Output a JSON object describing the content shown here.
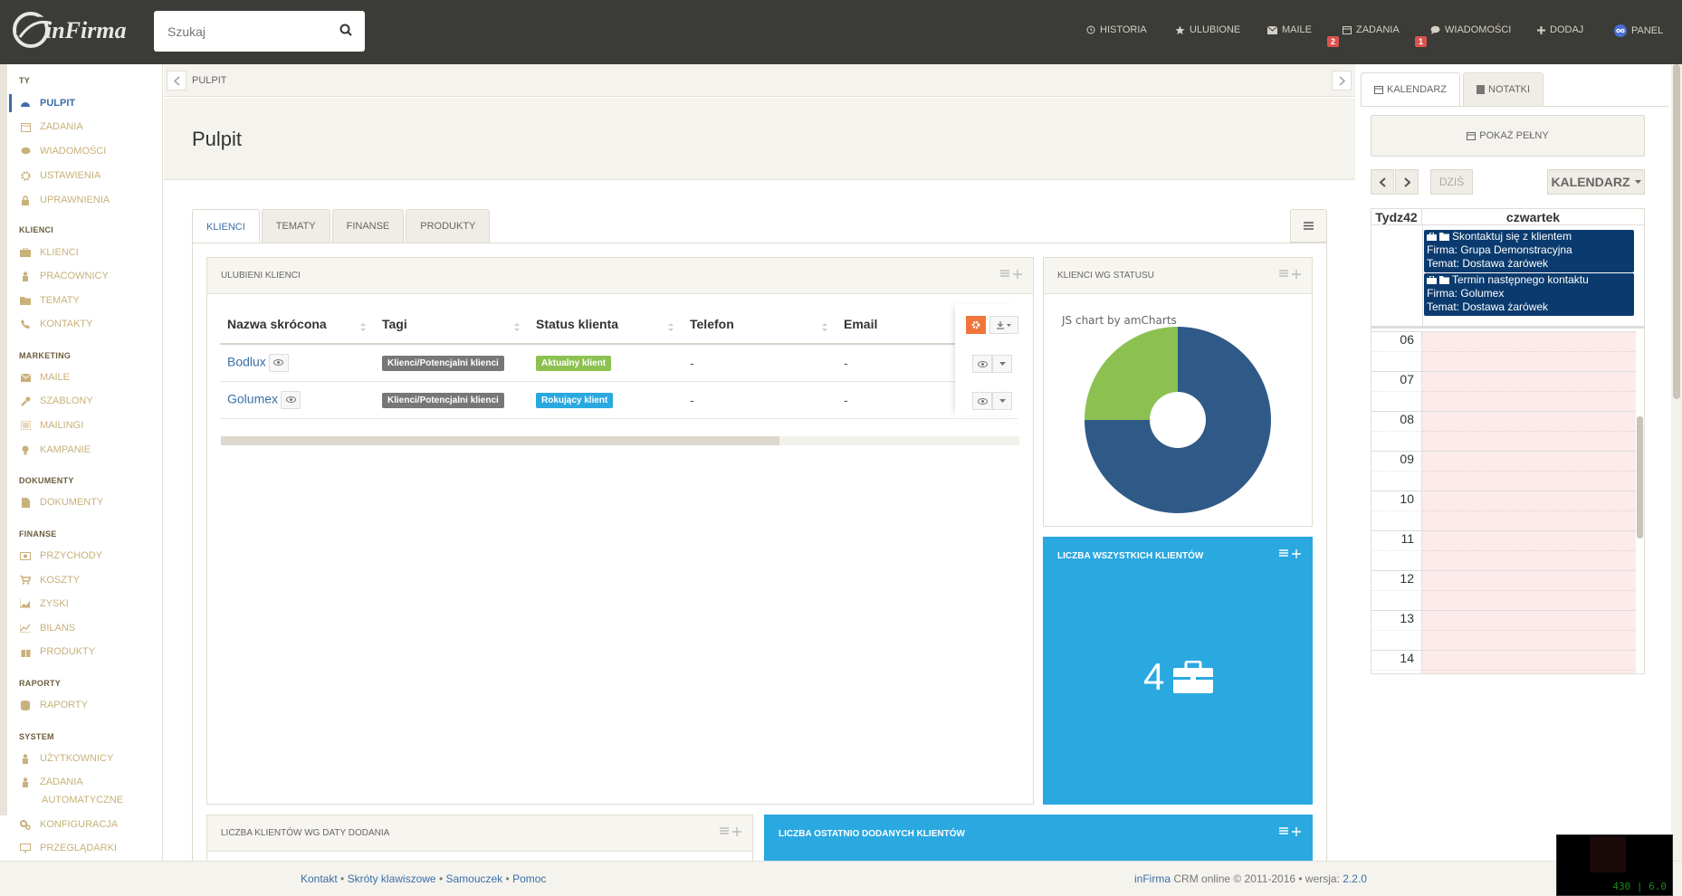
{
  "app": {
    "brand": "inFirma"
  },
  "search": {
    "placeholder": "Szukaj"
  },
  "topnav": [
    {
      "label": "HISTORIA",
      "icon": "history-icon"
    },
    {
      "label": "ULUBIONE",
      "icon": "star-icon"
    },
    {
      "label": "MAILE",
      "icon": "envelope-icon"
    },
    {
      "label": "ZADANIA",
      "icon": "calendar-icon",
      "badge": "2"
    },
    {
      "label": "WIADOMOŚCI",
      "icon": "chat-icon",
      "badge": "1"
    },
    {
      "label": "DODAJ",
      "icon": "plus-icon"
    },
    {
      "label": "PANEL",
      "icon": "infinity-icon"
    }
  ],
  "sidebar": {
    "sections": [
      "TY",
      "KLIENCI",
      "MARKETING",
      "DOKUMENTY",
      "FINANSE",
      "RAPORTY",
      "SYSTEM"
    ],
    "items": [
      {
        "label": "PULPIT",
        "icon": "dashboard-icon"
      },
      {
        "label": "ZADANIA",
        "icon": "calendar-icon"
      },
      {
        "label": "WIADOMOŚCI",
        "icon": "chat-icon"
      },
      {
        "label": "USTAWIENIA",
        "icon": "gear-icon"
      },
      {
        "label": "UPRAWNIENIA",
        "icon": "lock-icon"
      },
      {
        "label": "KLIENCI",
        "icon": "briefcase-icon"
      },
      {
        "label": "PRACOWNICY",
        "icon": "user-icon"
      },
      {
        "label": "TEMATY",
        "icon": "folder-icon"
      },
      {
        "label": "KONTAKTY",
        "icon": "phone-icon"
      },
      {
        "label": "MAILE",
        "icon": "envelope-icon"
      },
      {
        "label": "SZABLONY",
        "icon": "wrench-icon"
      },
      {
        "label": "MAILINGI",
        "icon": "list-icon"
      },
      {
        "label": "KAMPANIE",
        "icon": "bulb-icon"
      },
      {
        "label": "DOKUMENTY",
        "icon": "file-icon"
      },
      {
        "label": "PRZYCHODY",
        "icon": "money-icon"
      },
      {
        "label": "KOSZTY",
        "icon": "cart-icon"
      },
      {
        "label": "ZYSKI",
        "icon": "area-chart-icon"
      },
      {
        "label": "BILANS",
        "icon": "line-chart-icon"
      },
      {
        "label": "PRODUKTY",
        "icon": "gift-icon"
      },
      {
        "label": "RAPORTY",
        "icon": "database-icon"
      },
      {
        "label": "UŻYTKOWNICY",
        "icon": "user-icon"
      },
      {
        "label": "ZADANIA",
        "icon": "user-icon"
      },
      {
        "label": "AUTOMATYCZNE",
        "icon": ""
      },
      {
        "label": "KONFIGURACJA",
        "icon": "gears-icon"
      },
      {
        "label": "PRZEGLĄDARKI",
        "icon": "desktop-icon"
      }
    ]
  },
  "breadcrumb": {
    "current": "PULPIT"
  },
  "page": {
    "title": "Pulpit"
  },
  "tabs": [
    "KLIENCI",
    "TEMATY",
    "FINANSE",
    "PRODUKTY"
  ],
  "favorites": {
    "title": "ULUBIENI KLIENCI",
    "columns": [
      "Nazwa skrócona",
      "Tagi",
      "Status klienta",
      "Telefon",
      "Email"
    ],
    "rows": [
      {
        "name": "Bodlux",
        "tag": "Klienci/Potencjalni klienci",
        "status": "Aktualny klient",
        "phone": "-",
        "email": "-"
      },
      {
        "name": "Golumex",
        "tag": "Klienci/Potencjalni klienci",
        "status": "Rokujący klient",
        "phone": "-",
        "email": "-"
      }
    ]
  },
  "status_panel": {
    "title": "KLIENCI WG STATUSU",
    "credit": "JS chart by amCharts"
  },
  "chart_data": {
    "type": "pie",
    "slices": [
      {
        "value": 75,
        "color": "#2f5a88"
      },
      {
        "value": 25,
        "color": "#8cc152"
      }
    ]
  },
  "total_panel": {
    "title": "LICZBA WSZYSTKICH KLIENTÓW",
    "value": "4"
  },
  "bottom_panels": {
    "left_title": "LICZBA KLIENTÓW WG DATY DODANIA",
    "right_title": "LICZBA OSTATNIO DODANYCH KLIENTÓW"
  },
  "right": {
    "tabs": [
      "KALENDARZ",
      "NOTATKI"
    ],
    "show_full": "POKAŻ PEŁNY",
    "today": "DZIŚ",
    "view": "KALENDARZ",
    "week": "Tydz42",
    "day": "czwartek",
    "events": [
      {
        "title": "Skontaktuj się z klientem",
        "firma": "Firma: Grupa Demonstracyjna",
        "temat": "Temat: Dostawa żarówek"
      },
      {
        "title": "Termin następnego kontaktu",
        "firma": "Firma: Golumex",
        "temat": "Temat: Dostawa żarówek"
      }
    ],
    "hours": [
      "06",
      "07",
      "08",
      "09",
      "10",
      "11",
      "12",
      "13",
      "14"
    ]
  },
  "footer": {
    "links": [
      "Kontakt",
      "Skróty klawiszowe",
      "Samouczek",
      "Pomoc"
    ],
    "brand": "inFirma",
    "copy": "CRM online © 2011-2016 • wersja:",
    "version": "2.2.0",
    "fps": "430 | 6.0"
  },
  "colors": {
    "topbar": "#3b3b37",
    "accent": "#3a6fa8",
    "sidebar_text": "#c8b17a",
    "tile_blue": "#2aa8e0",
    "event": "#0b3b6e"
  }
}
